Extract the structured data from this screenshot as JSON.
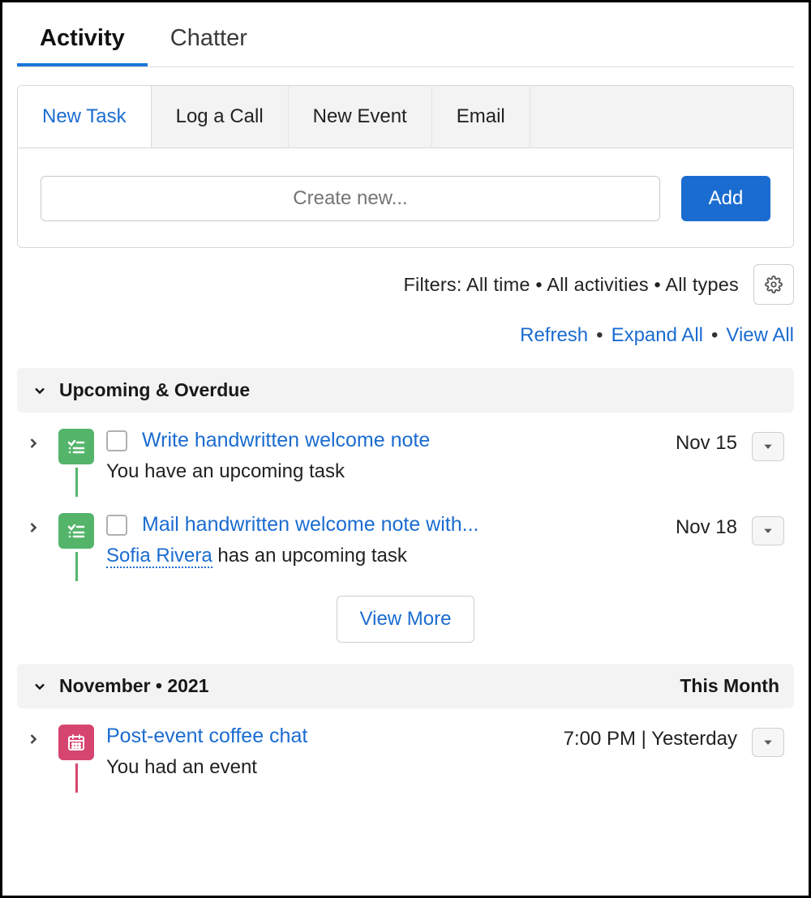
{
  "top_tabs": {
    "activity": "Activity",
    "chatter": "Chatter"
  },
  "action_tabs": {
    "new_task": "New Task",
    "log_call": "Log a Call",
    "new_event": "New Event",
    "email": "Email"
  },
  "create": {
    "placeholder": "Create new...",
    "add_label": "Add"
  },
  "filters": {
    "label": "Filters: All time • All activities • All types",
    "refresh": "Refresh",
    "expand_all": "Expand All",
    "view_all": "View All"
  },
  "sections": {
    "upcoming": {
      "title": "Upcoming & Overdue"
    },
    "month": {
      "title": "November • 2021",
      "badge": "This Month"
    }
  },
  "items": [
    {
      "title": "Write handwritten welcome note",
      "sub_prefix": "",
      "sub_user": "",
      "sub_text": "You have an upcoming task",
      "date": "Nov 15",
      "type": "task"
    },
    {
      "title": "Mail handwritten welcome note with...",
      "sub_user": "Sofia Rivera",
      "sub_text": " has an upcoming task",
      "date": "Nov 18",
      "type": "task"
    },
    {
      "title": "Post-event coffee chat",
      "sub_user": "",
      "sub_text": "You had an event",
      "date": "7:00 PM | Yesterday",
      "type": "event"
    }
  ],
  "view_more": "View More"
}
